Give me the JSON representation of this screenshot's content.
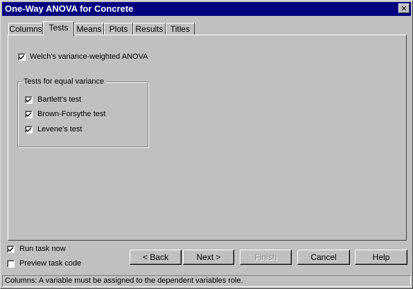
{
  "window": {
    "title": "One-Way ANOVA for Concrete",
    "close_label": "✕"
  },
  "tabs": [
    {
      "label": "Columns"
    },
    {
      "label": "Tests",
      "active": true
    },
    {
      "label": "Means"
    },
    {
      "label": "Plots"
    },
    {
      "label": "Results"
    },
    {
      "label": "Titles"
    }
  ],
  "tests": {
    "welch": {
      "label": "Welch's variance-weighted ANOVA",
      "checked": true
    },
    "equal_variance_group": {
      "title": "Tests for equal variance",
      "items": [
        {
          "label": "Bartlett's test",
          "checked": true
        },
        {
          "label": "Brown-Forsythe test",
          "checked": true
        },
        {
          "label": "Levene's test",
          "checked": true
        }
      ]
    }
  },
  "options": {
    "run_now": {
      "label": "Run task now",
      "checked": true
    },
    "preview": {
      "label": "Preview task code",
      "checked": false
    }
  },
  "buttons": {
    "back": "< Back",
    "next": "Next >",
    "finish": "Finish",
    "cancel": "Cancel",
    "help": "Help"
  },
  "status": "Columns: A variable must be assigned to the dependent variables role."
}
